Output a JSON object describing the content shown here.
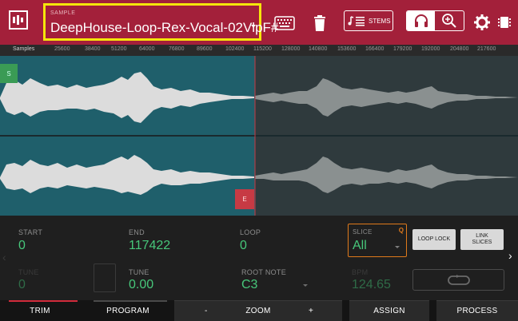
{
  "header": {
    "sample_label": "SAMPLE",
    "sample_name": "DeepHouse-Loop-Rex-Vocal-02VlpF#",
    "stems_label": "STEMS",
    "colors": {
      "bar": "#a3203a",
      "highlight": "#f5e60b"
    },
    "icons": [
      "menu-icon",
      "keyboard-icon",
      "trash-icon",
      "stems-icon",
      "headphones-icon",
      "zoom-icon",
      "gear-icon",
      "chip-icon"
    ]
  },
  "ruler": {
    "unit": "Samples",
    "ticks": [
      "25600",
      "38400",
      "51200",
      "64000",
      "76800",
      "89600",
      "102400",
      "115200",
      "128000",
      "140800",
      "153600",
      "166400",
      "179200",
      "192000",
      "204800",
      "217600"
    ]
  },
  "waveform": {
    "start_marker": "S",
    "end_marker": "E",
    "colors": {
      "selected": "#1f5f6b",
      "unselected": "#2f3a3d",
      "wave_selected": "#dcdcdc",
      "wave_unselected": "#8a9090",
      "start": "#3a9b55",
      "end": "#c73a44"
    }
  },
  "params": {
    "start": {
      "label": "START",
      "value": "0"
    },
    "end": {
      "label": "END",
      "value": "117422"
    },
    "loop": {
      "label": "LOOP",
      "value": "0"
    },
    "slice": {
      "label": "SLICE",
      "value": "All",
      "badge": "Q"
    },
    "loop_lock": "LOOP LOCK",
    "link_slices": "LINK SLICES",
    "hidden_left": {
      "label": "TUNE",
      "value": "0"
    },
    "tune": {
      "label": "TUNE",
      "value": "0.00"
    },
    "root_note": {
      "label": "ROOT NOTE",
      "value": "C3"
    },
    "bpm": {
      "label": "BPM",
      "value": "124.65"
    },
    "accent": "#47c77a"
  },
  "tabs": {
    "trim": "TRIM",
    "program": "PROGRAM",
    "zoom_minus": "-",
    "zoom": "ZOOM",
    "zoom_plus": "+",
    "assign": "ASSIGN",
    "process": "PROCESS"
  }
}
